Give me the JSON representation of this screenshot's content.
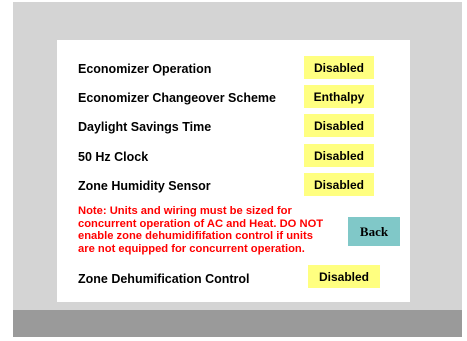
{
  "settings": [
    {
      "label": "Economizer Operation",
      "value": "Disabled"
    },
    {
      "label": "Economizer Changeover Scheme",
      "value": "Enthalpy"
    },
    {
      "label": "Daylight Savings Time",
      "value": "Disabled"
    },
    {
      "label": "50 Hz Clock",
      "value": "Disabled"
    },
    {
      "label": "Zone Humidity Sensor",
      "value": "Disabled"
    }
  ],
  "note": "Note: Units and wiring must be sized for\nconcurrent operation of AC and Heat. DO NOT\nenable zone dehumidififation control if units\nare not equipped for concurrent operation.",
  "back_label": "Back",
  "dehum": {
    "label": "Zone Dehumification Control",
    "value": "Disabled"
  }
}
